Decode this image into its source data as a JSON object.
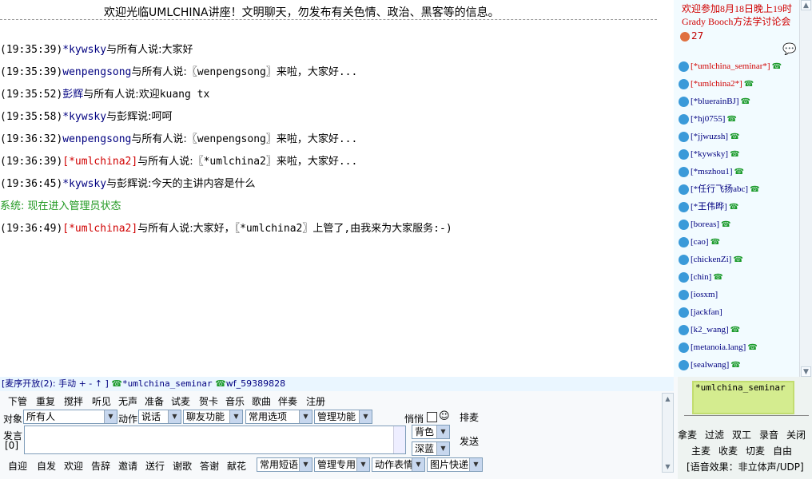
{
  "banner": "欢迎光临UMLCHINA讲座！文明聊天，勿发布有关色情、政治、黑客等的信息。",
  "messages": [
    {
      "time": "(19:35:39)",
      "from": "*kywsky",
      "mid": "与所有人说:",
      "text": "大家好",
      "color": "blue"
    },
    {
      "time": "(19:35:39)",
      "from": "wenpengsong",
      "mid": "与所有人说:",
      "text": "〖wenpengsong〗来啦，大家好...",
      "color": "blue"
    },
    {
      "time": "(19:35:52)",
      "from": "彭辉",
      "mid": "与所有人说:",
      "text": "欢迎kuang tx",
      "color": "blue"
    },
    {
      "time": "(19:35:58)",
      "from": "*kywsky",
      "mid": "与彭辉说:",
      "text": "呵呵",
      "color": "blue"
    },
    {
      "time": "(19:36:32)",
      "from": "wenpengsong",
      "mid": "与所有人说:",
      "text": "〖wenpengsong〗来啦，大家好...",
      "color": "blue"
    },
    {
      "time": "(19:36:39)",
      "from": "[*umlchina2]",
      "mid": "与所有人说:",
      "text": "〖*umlchina2〗来啦，大家好...",
      "color": "red"
    },
    {
      "time": "(19:36:45)",
      "from": "*kywsky",
      "mid": "与彭辉说:",
      "text": "今天的主讲内容是什么",
      "color": "blue"
    },
    {
      "time": "",
      "from": "",
      "mid": "系统:",
      "text": "现在进入管理员状态",
      "color": "sys"
    },
    {
      "time": "(19:36:49)",
      "from": "[*umlchina2]",
      "mid": "与所有人说:",
      "text": "大家好，〖*umlchina2〗上管了,由我来为大家服务:-)",
      "color": "red"
    }
  ],
  "notice": [
    "欢迎参加8月18日晚上19时",
    "Grady Booch方法学讨论会"
  ],
  "online_count": "27",
  "users": [
    {
      "name": "[*umlchina_seminar*]",
      "red": true,
      "phone": true
    },
    {
      "name": "[*umlchina2*]",
      "red": true,
      "phone": true
    },
    {
      "name": "[*bluerainBJ]",
      "red": false,
      "phone": true
    },
    {
      "name": "[*hj0755]",
      "red": false,
      "phone": true
    },
    {
      "name": "[*jjwuzsh]",
      "red": false,
      "phone": true
    },
    {
      "name": "[*kywsky]",
      "red": false,
      "phone": true
    },
    {
      "name": "[*mszhou1]",
      "red": false,
      "phone": true
    },
    {
      "name": "[*任行飞扬abc]",
      "red": false,
      "phone": true
    },
    {
      "name": "[*王伟晔]",
      "red": false,
      "phone": true
    },
    {
      "name": "[boreas]",
      "red": false,
      "phone": true
    },
    {
      "name": "[cao]",
      "red": false,
      "phone": true
    },
    {
      "name": "[chickenZi]",
      "red": false,
      "phone": true
    },
    {
      "name": "[chin]",
      "red": false,
      "phone": true
    },
    {
      "name": "[iosxm]",
      "red": false,
      "phone": false
    },
    {
      "name": "[jackfan]",
      "red": false,
      "phone": false
    },
    {
      "name": "[k2_wang]",
      "red": false,
      "phone": true
    },
    {
      "name": "[metanoia.lang]",
      "red": false,
      "phone": true
    },
    {
      "name": "[sealwang]",
      "red": false,
      "phone": true
    }
  ],
  "mic_bar": {
    "label": "[麦序开放(2):",
    "mode": "手动",
    "controls": "+ - ↑ ]",
    "user1": "*umlchina_seminar",
    "user2": "wf_59389828"
  },
  "toolbar1": [
    "下管",
    "重复",
    "搅拌",
    "听见",
    "无声",
    "准备",
    "试麦",
    "贺卡",
    "音乐",
    "歌曲",
    "伴奏",
    "注册"
  ],
  "target_label": "对象",
  "target_value": "所有人",
  "action_label": "动作",
  "action_value": "说话",
  "chat_func": "聊友功能",
  "common_options": "常用选项",
  "admin_func": "管理功能",
  "whisper_label": "悄悄",
  "queue_label": "排麦",
  "speak_label": "发言",
  "speak_count": "[0]",
  "bgcolor": "背色",
  "color_value": "深蓝",
  "send": "发送",
  "toolbar2": [
    "自迎",
    "自发",
    "欢迎",
    "告辞",
    "邀请",
    "送行",
    "谢歌",
    "答谢",
    "献花"
  ],
  "common_phrases": "常用短语",
  "admin_use": "管理专用",
  "action_emote": "动作表情",
  "image_quick": "图片快递",
  "voice_current": "*umlchina_seminar",
  "voice_row1": [
    "拿麦",
    "过滤",
    "双工",
    "录音",
    "关闭"
  ],
  "voice_row2": [
    "主麦",
    "收麦",
    "切麦",
    "自由"
  ],
  "voice_effect": "[语音效果：非立体声/UDP]"
}
